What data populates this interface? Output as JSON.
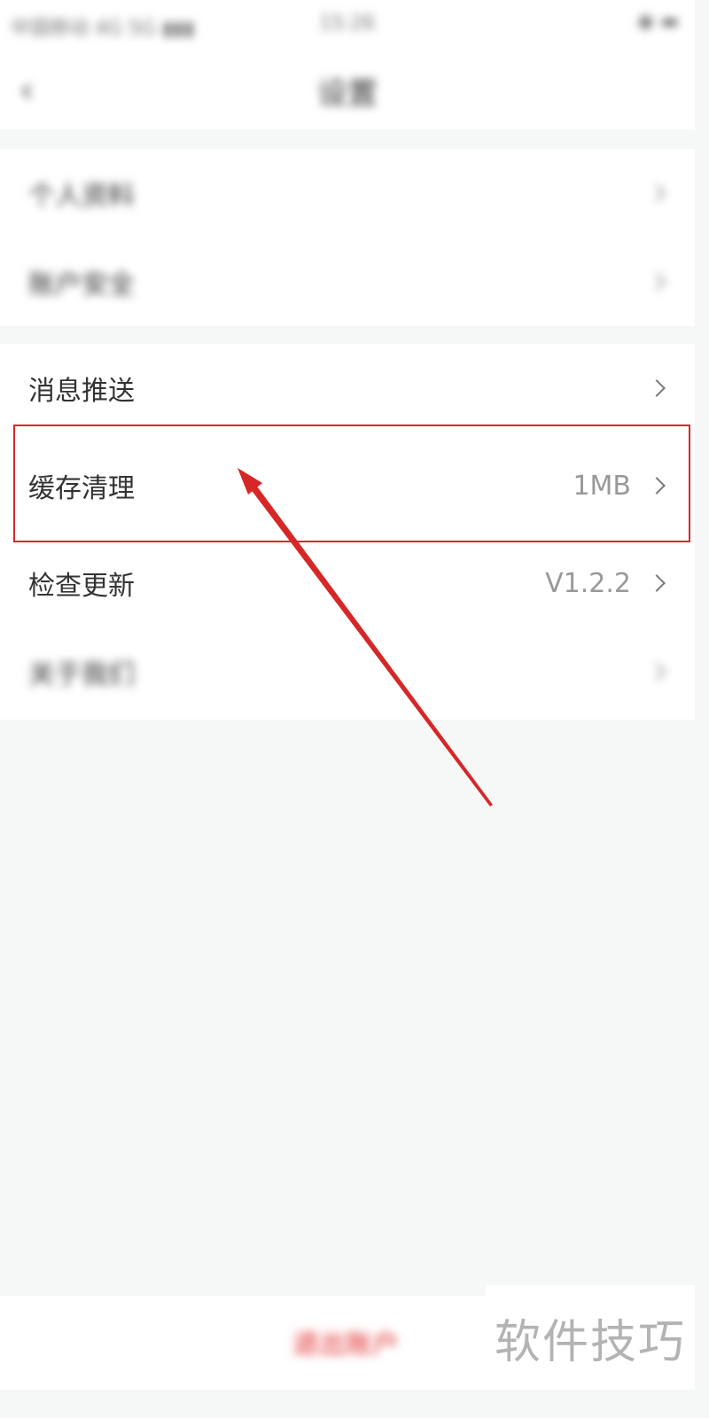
{
  "status_bar": {
    "carrier": "中国移动 4G 5G ▮▮▮",
    "time": "15:26",
    "battery": "◉ ▬"
  },
  "nav": {
    "title": "设置",
    "back_icon": "chevron-left-icon"
  },
  "group1": {
    "items": [
      {
        "label": "个人资料"
      },
      {
        "label": "账户安全"
      }
    ]
  },
  "group2": {
    "items": [
      {
        "label": "消息推送",
        "value": ""
      },
      {
        "label": "缓存清理",
        "value": "1MB"
      },
      {
        "label": "检查更新",
        "value": "V1.2.2"
      },
      {
        "label": "关于我们",
        "value": ""
      }
    ]
  },
  "annotation": {
    "highlight_color": "#d62727"
  },
  "bottom": {
    "logout_label": "退出账户"
  },
  "watermark": {
    "text": "软件技巧"
  }
}
